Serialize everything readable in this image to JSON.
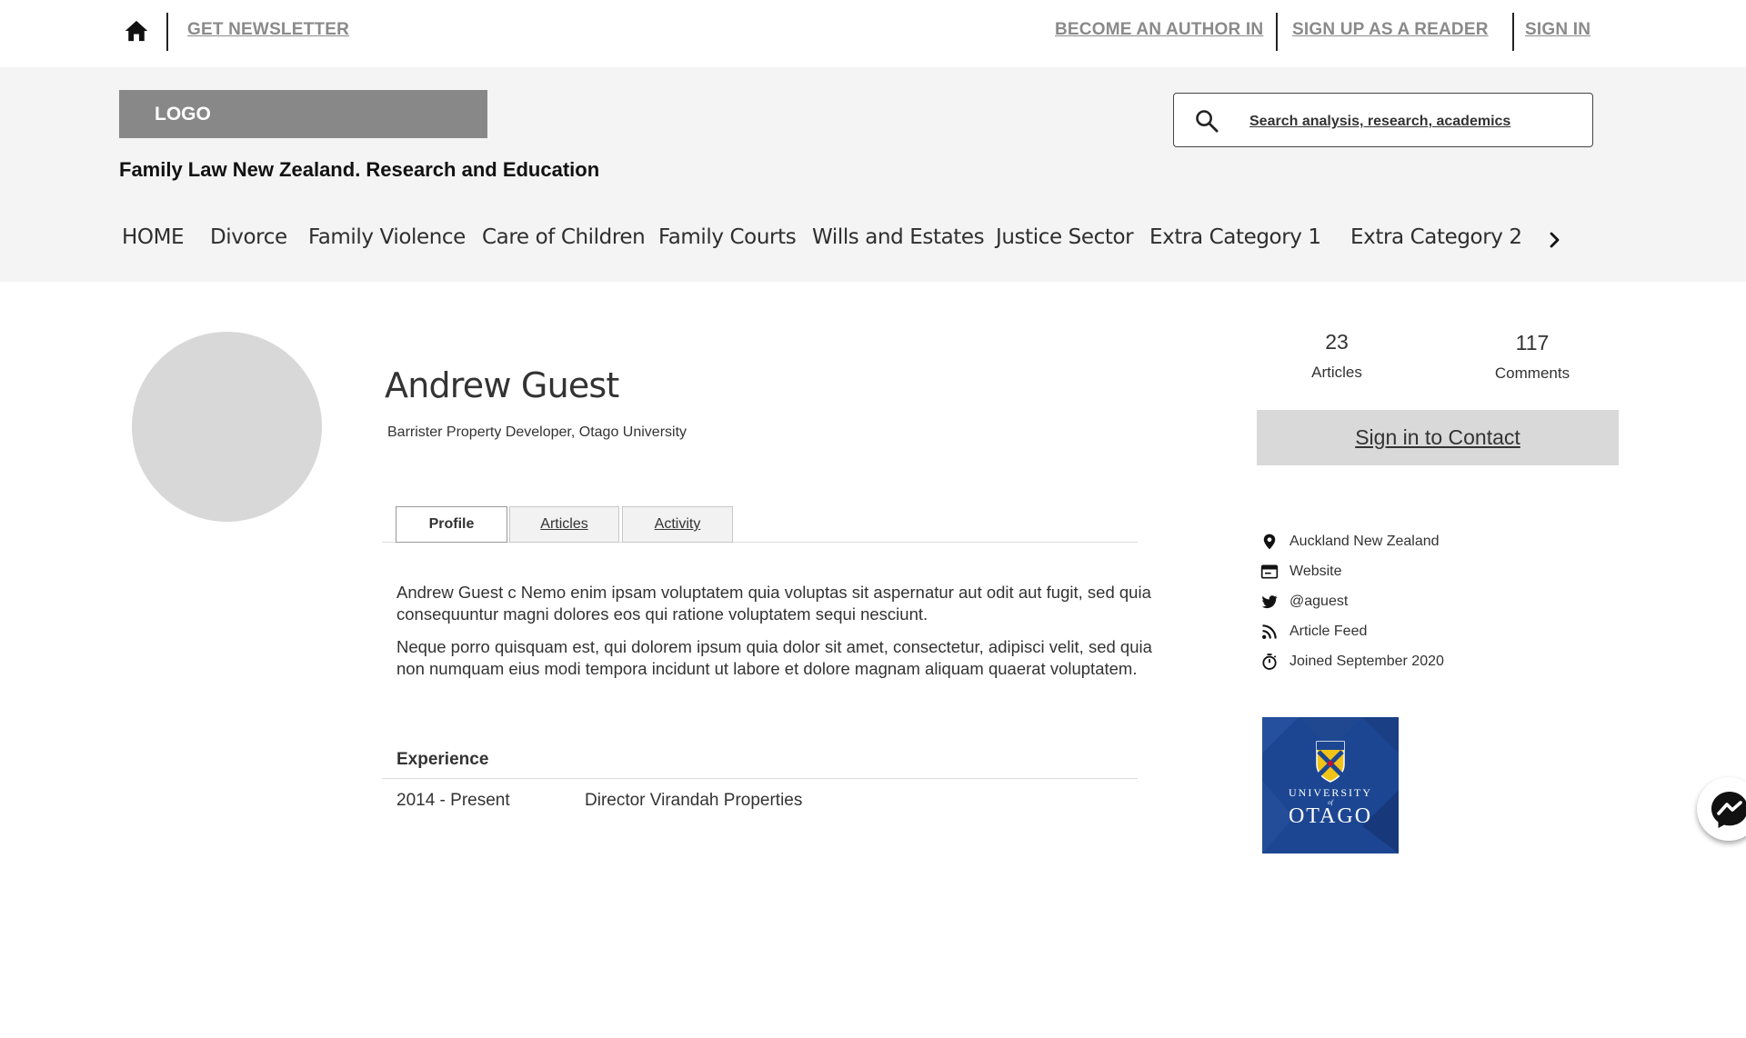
{
  "topbar": {
    "newsletter": "GET NEWSLETTER",
    "become_author": "BECOME AN AUTHOR IN",
    "sign_up_reader": "SIGN UP AS A READER",
    "sign_in": "SIGN IN"
  },
  "header": {
    "logo": "LOGO",
    "tagline": "Family Law New Zealand. Research and Education",
    "search_placeholder": "Search analysis, research, academics"
  },
  "nav": {
    "items": [
      "HOME",
      "Divorce",
      "Family Violence",
      "Care of Children",
      "Family Courts",
      "Wills and Estates",
      "Justice Sector",
      "Extra Category 1",
      "Extra Category 2"
    ]
  },
  "profile": {
    "name": "Andrew Guest",
    "role": "Barrister Property Developer, Otago University",
    "tabs": [
      "Profile",
      "Articles",
      "Activity"
    ],
    "active_tab": "Profile",
    "bio": [
      "Andrew Guest c Nemo enim ipsam voluptatem quia voluptas sit aspernatur aut odit aut fugit, sed quia consequuntur magni dolores eos qui ratione voluptatem sequi nesciunt.",
      "Neque porro quisquam est, qui dolorem ipsum quia dolor sit amet, consectetur, adipisci velit, sed quia non numquam eius modi tempora incidunt ut labore et dolore magnam aliquam quaerat voluptatem."
    ],
    "experience_title": "Experience",
    "experience": [
      {
        "years": "2014 - Present",
        "role": "Director Virandah Properties"
      }
    ]
  },
  "stats": {
    "articles_count": "23",
    "articles_label": "Articles",
    "comments_count": "117",
    "comments_label": "Comments"
  },
  "contact_button": "Sign in to Contact",
  "meta": {
    "location": "Auckland New Zealand",
    "website": "Website",
    "twitter": "@aguest",
    "feed": "Article Feed",
    "joined": "Joined September 2020"
  },
  "university_logo": {
    "line1": "UNIVERSITY",
    "line2": "of",
    "line3": "OTAGO"
  },
  "colors": {
    "header_bg": "#f4f4f4",
    "logo_bg": "#888888",
    "link_gray": "#8a8a8a",
    "avatar": "#d8d8d8",
    "button_bg": "#d9d9d9",
    "otago_blue": "#1c4692",
    "crest_gold": "#f2c318"
  },
  "icons": {
    "home": "home-icon",
    "search": "search-icon",
    "nav_next": "chevron-right-icon",
    "location": "map-pin-icon",
    "website": "browser-window-icon",
    "twitter": "twitter-bird-icon",
    "feed": "rss-icon",
    "joined": "stopwatch-icon",
    "messenger": "messenger-icon"
  }
}
